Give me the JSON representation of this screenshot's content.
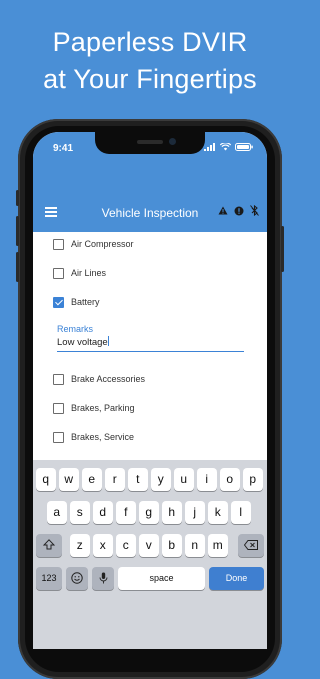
{
  "headline": {
    "line1": "Paperless DVIR",
    "line2": "at Your Fingertips"
  },
  "status_bar": {
    "time": "9:41"
  },
  "app_bar": {
    "title": "Vehicle Inspection"
  },
  "items": [
    {
      "label": "Air Compressor",
      "checked": false
    },
    {
      "label": "Air Lines",
      "checked": false
    },
    {
      "label": "Battery",
      "checked": true
    },
    {
      "label": "Brake Accessories",
      "checked": false
    },
    {
      "label": "Brakes, Parking",
      "checked": false
    },
    {
      "label": "Brakes, Service",
      "checked": false
    }
  ],
  "remarks": {
    "label": "Remarks",
    "value": "Low voltage"
  },
  "keyboard": {
    "row1": [
      "q",
      "w",
      "e",
      "r",
      "t",
      "y",
      "u",
      "i",
      "o",
      "p"
    ],
    "row2": [
      "a",
      "s",
      "d",
      "f",
      "g",
      "h",
      "j",
      "k",
      "l"
    ],
    "row3": [
      "z",
      "x",
      "c",
      "v",
      "b",
      "n",
      "m"
    ],
    "numbers_key": "123",
    "space_key": "space",
    "done_key": "Done"
  },
  "colors": {
    "brand": "#4a8fd6",
    "accent": "#3b82d6",
    "keyboard_bg": "#d2d5db"
  }
}
